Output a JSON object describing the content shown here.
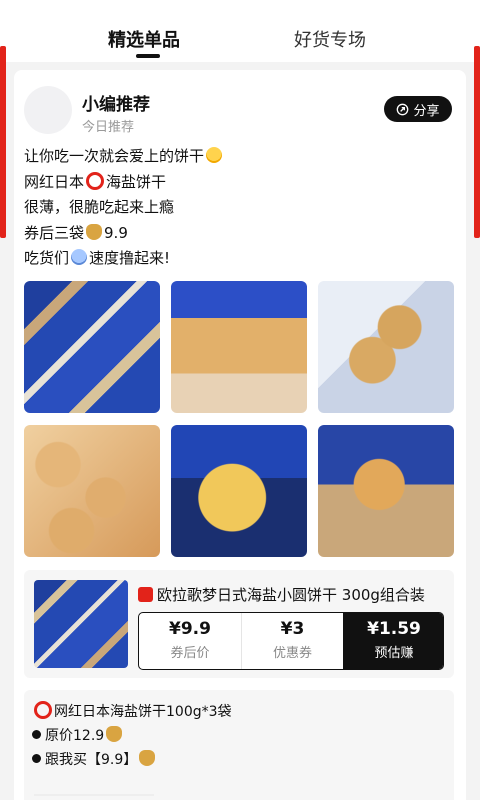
{
  "tabs": [
    {
      "label": "精选单品",
      "active": true
    },
    {
      "label": "好货专场",
      "active": false
    }
  ],
  "post": {
    "author": "小编推荐",
    "subtitle": "今日推荐",
    "share_label": "分享",
    "lines": [
      {
        "text_before": "让你吃一次就会爱上的饼干",
        "icon": "heart-eyes-emoji",
        "text_after": ""
      },
      {
        "text_before": "网红日本",
        "icon": "red-ring-emoji",
        "text_after": "海盐饼干"
      },
      {
        "text_before": "很薄，很脆吃起来上瘾",
        "icon": "",
        "text_after": ""
      },
      {
        "text_before": "券后三袋",
        "icon": "money-bag-emoji",
        "text_after": "9.9"
      },
      {
        "text_before": "吃货们",
        "icon": "screaming-face-emoji",
        "text_after": "速度撸起来!"
      }
    ]
  },
  "photos": [
    {
      "name": "cookie-packs-box"
    },
    {
      "name": "cookie-pack-hand"
    },
    {
      "name": "cookies-in-bag"
    },
    {
      "name": "cookies-stacked"
    },
    {
      "name": "single-cracker-closeup"
    },
    {
      "name": "cookie-held-hand"
    }
  ],
  "product": {
    "title": "欧拉歌梦日式海盐小圆饼干 300g组合装",
    "prices": [
      {
        "value": "¥9.9",
        "label": "券后价"
      },
      {
        "value": "¥3",
        "label": "优惠券"
      },
      {
        "value": "¥1.59",
        "label": "预估赚"
      }
    ]
  },
  "note": {
    "line1": "网红日本海盐饼干100g*3袋",
    "line2": "原价12.9",
    "line3": "跟我买【9.9】"
  }
}
